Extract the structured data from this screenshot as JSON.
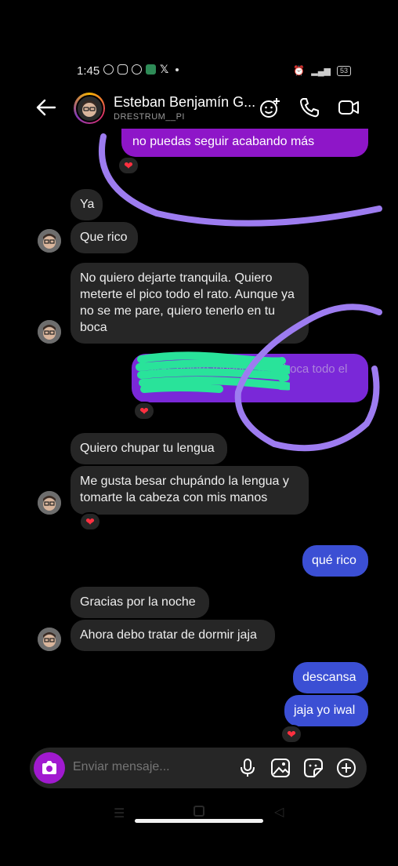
{
  "status_bar": {
    "time": "1:45",
    "app_icons": [
      "whatsapp-icon",
      "instagram-icon",
      "facebook-icon",
      "app-icon",
      "x-icon"
    ],
    "battery": "53"
  },
  "header": {
    "name": "Esteban Benjamín G...",
    "username": "DRESTRUM__PI"
  },
  "messages": [
    {
      "side": "out",
      "text": "no puedas seguir acabando más",
      "style": "purple",
      "reaction": "❤"
    },
    {
      "side": "in",
      "text": "Ya"
    },
    {
      "side": "in",
      "text": "Que rico"
    },
    {
      "side": "in",
      "text": "No quiero dejarte tranquila. Quiero meterte el pico todo el rato. Aunque ya no se me pare, quiero tenerlo en tu boca"
    },
    {
      "side": "out",
      "text": "...tirás quiero tenerlo en mi boca todo el rato aunque...",
      "style": "purple",
      "redacted": true,
      "reaction": "❤"
    },
    {
      "side": "in",
      "text": "Quiero chupar tu lengua"
    },
    {
      "side": "in",
      "text": "Me gusta besar chupándo la lengua y tomarte la cabeza con mis manos",
      "reaction": "❤"
    },
    {
      "side": "out",
      "text": "qué rico"
    },
    {
      "side": "in",
      "text": "Gracias por la noche"
    },
    {
      "side": "in",
      "text": "Ahora debo tratar de dormir jaja"
    },
    {
      "side": "out",
      "text": "descansa"
    },
    {
      "side": "out",
      "text": "jaja yo iwal",
      "reaction": "❤"
    }
  ],
  "composer": {
    "placeholder": "Enviar mensaje..."
  },
  "colors": {
    "outgoing": "#3b4fd4",
    "purple_bubble": "#8e16c8",
    "incoming": "#262626",
    "annotation": "#9d7cf0",
    "redaction": "#29e39a",
    "heart": "#ff3040"
  }
}
